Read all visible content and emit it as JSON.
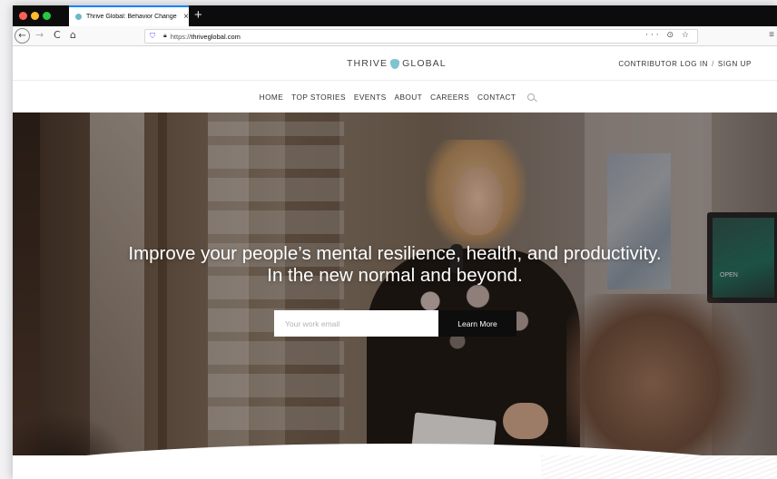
{
  "browser": {
    "tab_title": "Thrive Global: Behavior Change",
    "tab_close": "×",
    "new_tab": "+",
    "nav": {
      "back": "←",
      "forward": "→",
      "reload": "C",
      "home": "⌂"
    },
    "url_prefix": "https://",
    "url_domain": "thriveglobal.com",
    "url_actions": "··· ⊙ ☆",
    "menu": "≡"
  },
  "header": {
    "logo_left": "THRIVE",
    "logo_right": "GLOBAL",
    "contributor_login": "CONTRIBUTOR LOG IN",
    "separator": "/",
    "sign_up": "SIGN UP"
  },
  "nav": {
    "items": [
      "HOME",
      "TOP STORIES",
      "EVENTS",
      "ABOUT",
      "CAREERS",
      "CONTACT"
    ]
  },
  "hero": {
    "headline_line1": "Improve your people’s mental resilience, health, and productivity.",
    "headline_line2": "In the new normal and beyond.",
    "email_placeholder": "Your work email",
    "email_value": "",
    "submit_label": "Learn More",
    "monitor_text": "OPEN"
  },
  "colors": {
    "tab_accent": "#0a84ff",
    "logo_mark": "#7ec3cf",
    "button_bg": "#0d0d0d"
  }
}
